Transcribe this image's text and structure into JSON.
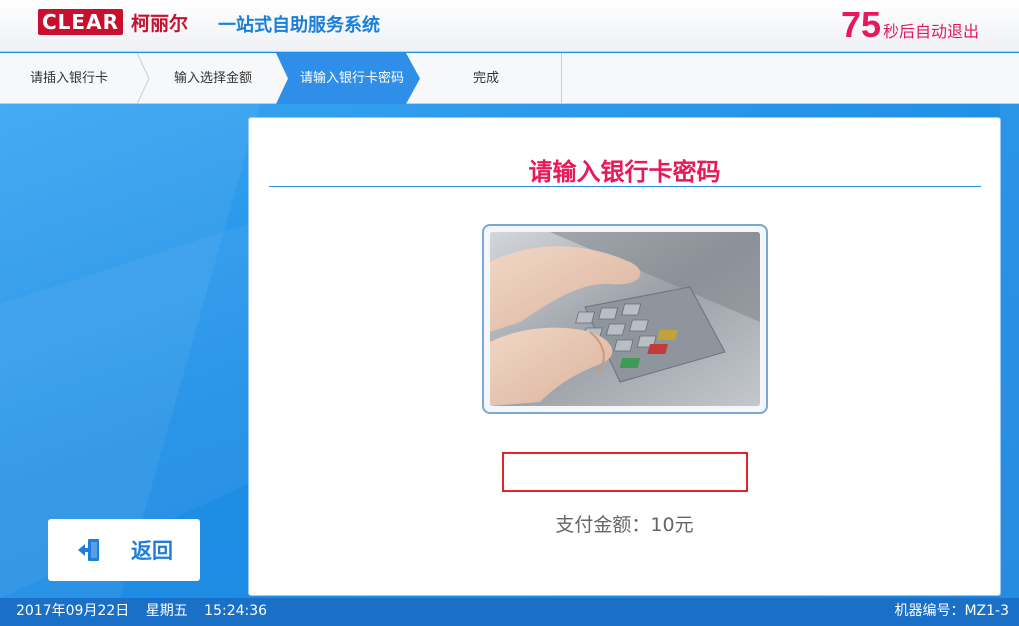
{
  "header": {
    "logo_text": "CLEAR",
    "logo_cn": "柯丽尔",
    "system_name": "一站式自助服务系统",
    "countdown_number": "75",
    "countdown_text": "秒后自动退出"
  },
  "steps": [
    {
      "label": "请插入银行卡",
      "active": false
    },
    {
      "label": "输入选择金额",
      "active": false
    },
    {
      "label": "请输入银行卡密码",
      "active": true
    },
    {
      "label": "完成",
      "active": false
    }
  ],
  "panel": {
    "title": "请输入银行卡密码",
    "password_value": "",
    "pay_amount": "支付金额：10元"
  },
  "back_button": {
    "label": "返回",
    "icon": "exit-door-icon"
  },
  "footer": {
    "date": "2017年09月22日",
    "weekday": "星期五",
    "time": "15:24:36",
    "machine_id": "机器编号：MZ1-3"
  },
  "colors": {
    "accent_pink": "#e8195a",
    "brand_red": "#c8102e",
    "primary_blue": "#1f8fe6",
    "active_step": "#2f8fe8",
    "input_border": "#e02626"
  }
}
